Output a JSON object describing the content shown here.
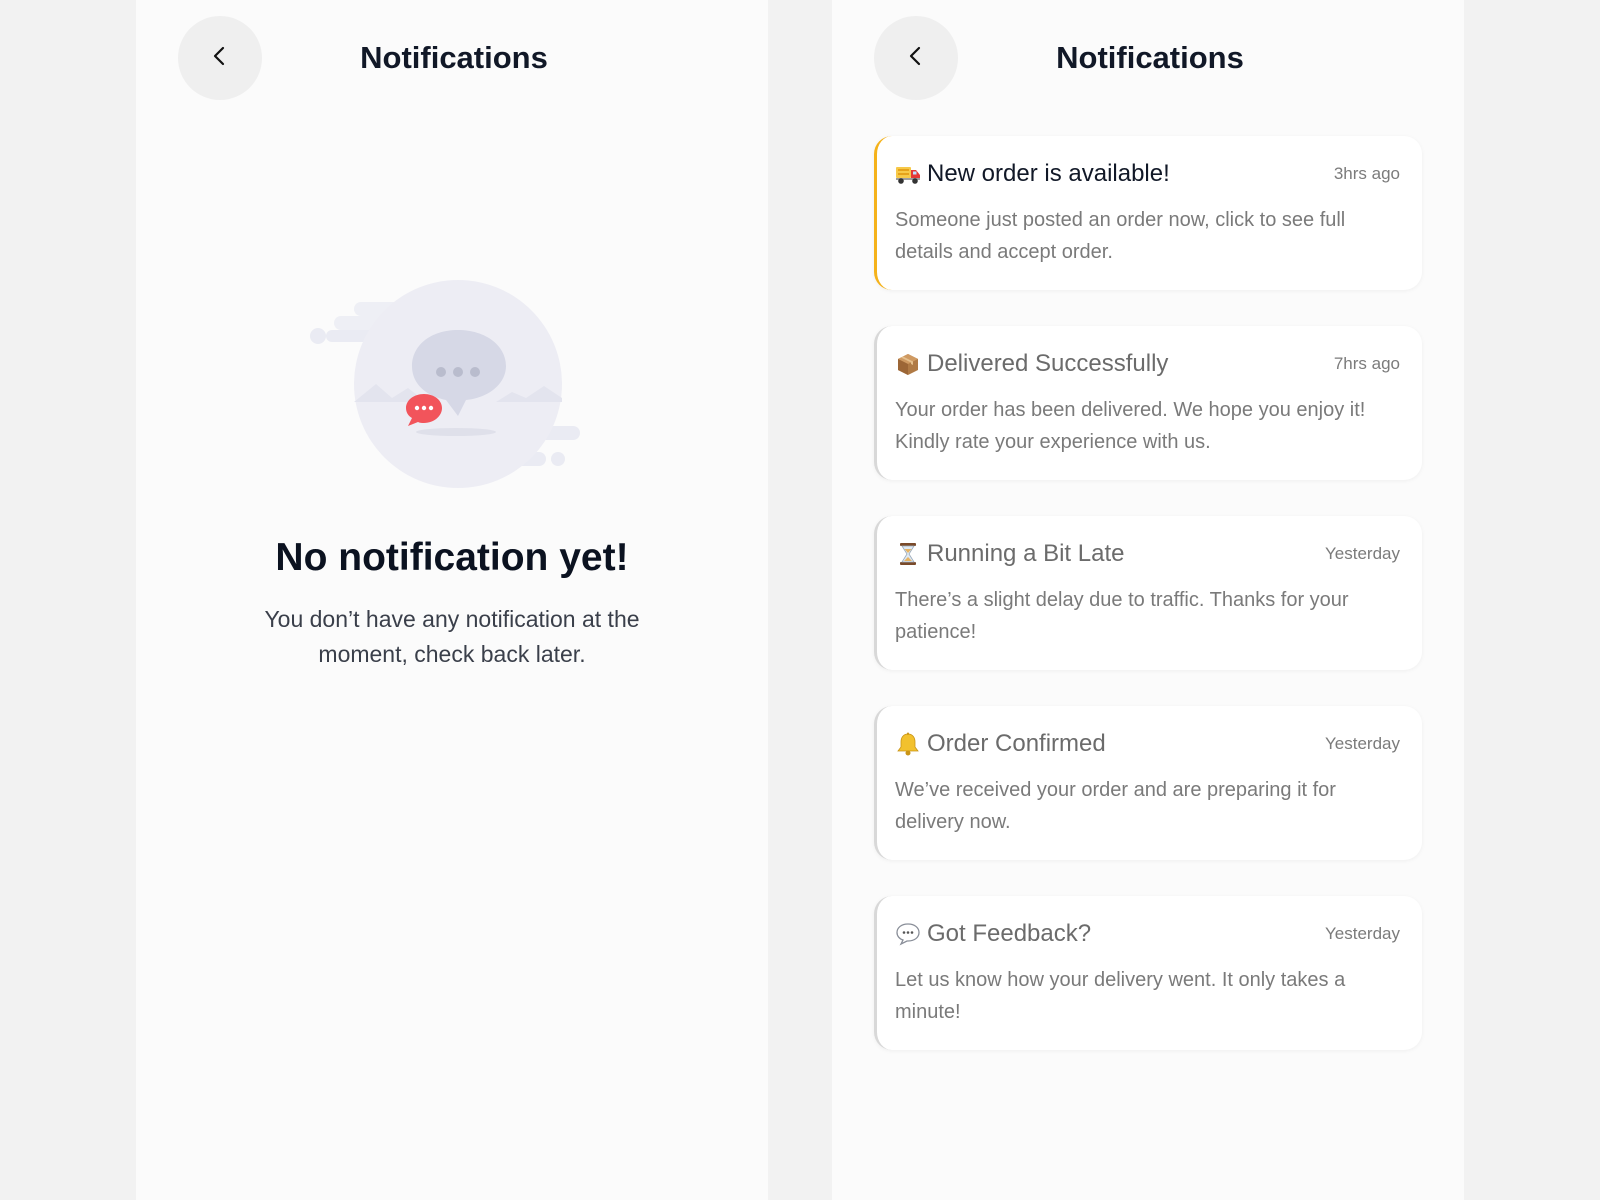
{
  "empty_screen": {
    "header_title": "Notifications",
    "empty_title": "No notification yet!",
    "empty_message": "You don’t have any notification at the moment, check back later.",
    "illustration_icon": "chat-bubble-illustration"
  },
  "list_screen": {
    "header_title": "Notifications",
    "notifications": [
      {
        "icon": "truck-icon",
        "title": "New order is available!",
        "time": "3hrs ago",
        "body": "Someone just posted an order now, click to see full details and accept order.",
        "unread": true
      },
      {
        "icon": "package-icon",
        "title": "Delivered Successfully",
        "time": "7hrs ago",
        "body": "Your order has been delivered. We hope you enjoy it! Kindly rate your experience with us.",
        "unread": false
      },
      {
        "icon": "hourglass-icon",
        "title": "Running a Bit Late",
        "time": "Yesterday",
        "body": "There’s a slight delay due to traffic. Thanks for your patience!",
        "unread": false
      },
      {
        "icon": "bell-icon",
        "title": "Order Confirmed",
        "time": "Yesterday",
        "body": "We’ve received your order and are preparing it for delivery now.",
        "unread": false
      },
      {
        "icon": "speech-bubble-icon",
        "title": "Got Feedback?",
        "time": "Yesterday",
        "body": "Let us know how your delivery went. It only takes a minute!",
        "unread": false
      }
    ]
  },
  "colors": {
    "unread_accent": "#f5b21a",
    "read_accent": "#d8d8d8",
    "title_dark": "#111827",
    "badge_red": "#f2545b"
  }
}
